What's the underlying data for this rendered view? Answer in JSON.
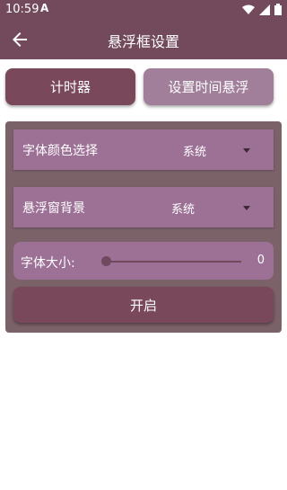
{
  "status_bar": {
    "time": "10:59",
    "notification_glyph": "A",
    "icons": [
      "wifi-icon",
      "signal-icon",
      "battery-icon"
    ]
  },
  "app_bar": {
    "title": "悬浮框设置",
    "back_icon": "arrow-left-icon"
  },
  "tabs": {
    "timer_label": "计时器",
    "float_time_label": "设置时间悬浮"
  },
  "settings": {
    "font_color": {
      "label": "字体颜色选择",
      "value": "系统"
    },
    "background": {
      "label": "悬浮窗背景",
      "value": "系统"
    },
    "font_size": {
      "label": "字体大小:",
      "value": "0",
      "level": 0
    },
    "start_label": "开启"
  },
  "colors": {
    "primary": "#734a5b",
    "button_dark": "#79485a",
    "button_light": "#a17f9b",
    "panel": "#7b6168",
    "row": "#9d7096"
  }
}
